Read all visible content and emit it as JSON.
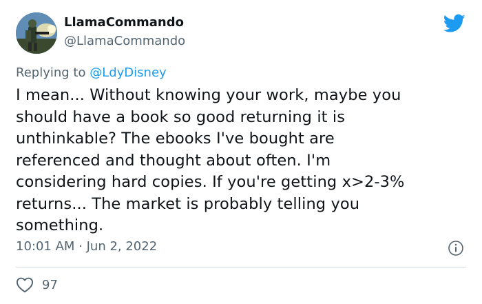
{
  "tweet": {
    "author_name": "LlamaCommando",
    "author_handle": "@LlamaCommando",
    "replying_prefix": "Replying to ",
    "replying_to": "@LdyDisney",
    "lines": [
      "I mean... Without knowing your work, maybe you",
      "should have a book so good returning it is",
      "unthinkable? The ebooks I've bought are",
      "referenced and thought about often. I'm",
      "considering hard copies. If you're getting x>2-3%",
      "returns... The market is probably telling you",
      "something."
    ],
    "timestamp": "10:01 AM · Jun 2, 2022",
    "like_count": "97"
  },
  "icons": {
    "brand": "twitter-bird-icon",
    "info": "info-icon",
    "like": "heart-icon"
  },
  "colors": {
    "brand_blue": "#1d9bf0",
    "text_primary": "#0f1419",
    "text_secondary": "#536471",
    "divider": "#cfd9de"
  }
}
